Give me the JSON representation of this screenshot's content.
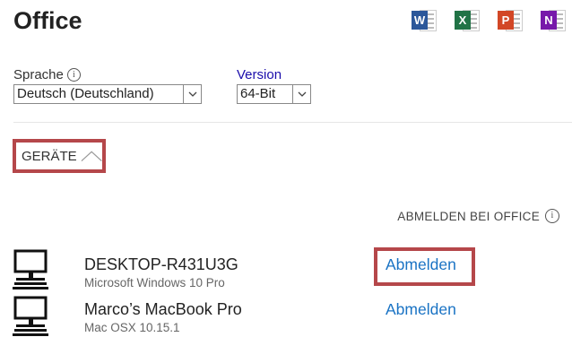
{
  "app_title": "Office",
  "apps": [
    {
      "name": "word-icon",
      "letter": "W",
      "color": "#2b579a"
    },
    {
      "name": "excel-icon",
      "letter": "X",
      "color": "#217346"
    },
    {
      "name": "powerpoint-icon",
      "letter": "P",
      "color": "#d24726"
    },
    {
      "name": "onenote-icon",
      "letter": "N",
      "color": "#7719aa"
    }
  ],
  "language": {
    "label": "Sprache",
    "value": "Deutsch (Deutschland)"
  },
  "version": {
    "label": "Version",
    "value": "64-Bit"
  },
  "devices_section": {
    "label": "GERÄTE"
  },
  "signout_all_label": "ABMELDEN BEI OFFICE",
  "devices": [
    {
      "name": "DESKTOP-R431U3G",
      "os": "Microsoft Windows 10 Pro",
      "action": "Abmelden"
    },
    {
      "name": "Marco’s MacBook Pro",
      "os": "Mac OSX 10.15.1",
      "action": "Abmelden"
    }
  ],
  "colors": {
    "highlight": "#b5474a",
    "link": "#1a73c4"
  }
}
